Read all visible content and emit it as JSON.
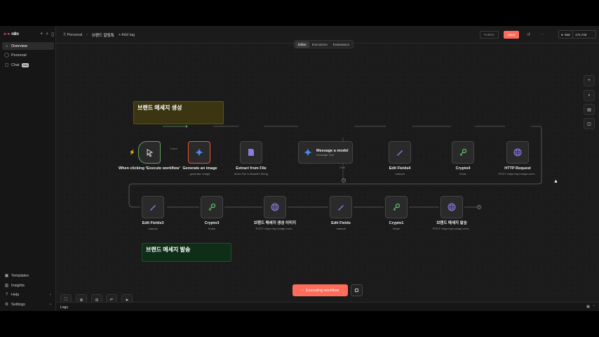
{
  "sidebar": {
    "brand": "n8n",
    "items": [
      {
        "label": "Overview",
        "icon": "home-icon"
      },
      {
        "label": "Personal",
        "icon": "user-icon"
      },
      {
        "label": "Chat",
        "icon": "chat-icon",
        "badge": "beta"
      }
    ],
    "bottom_items": [
      {
        "label": "Templates"
      },
      {
        "label": "Insights"
      },
      {
        "label": "Help"
      },
      {
        "label": "Settings"
      }
    ]
  },
  "header": {
    "project": "Personal",
    "workflow_name": "브랜드 알림톡",
    "add_tag": "+ Add tag",
    "publish": "Publish",
    "save": "Save",
    "star_label": "Star",
    "star_count": "172,746"
  },
  "tabs": [
    "Editor",
    "Executions",
    "Evaluations"
  ],
  "stickies": {
    "top": "브랜드 메세지 생성",
    "bottom": "브랜드 메세지 발송"
  },
  "nodes": {
    "trigger": {
      "label": "When clicking ‘Execute workflow’"
    },
    "gen_image": {
      "label": "Generate an image",
      "sub": "generate: image"
    },
    "extract": {
      "label": "Extract from File",
      "sub": "Move File to Base64 String"
    },
    "message_model": {
      "label": "Message a model",
      "sub": "message: text"
    },
    "edit_fields4": {
      "label": "Edit Fields4",
      "sub": "manual"
    },
    "crypto4": {
      "label": "Crypto4",
      "sub": "hmac"
    },
    "http_request": {
      "label": "HTTP Request",
      "sub": "POST: https://api.solapi.com/..."
    },
    "edit_fields3": {
      "label": "Edit Fields3",
      "sub": "manual"
    },
    "crypto3": {
      "label": "Crypto3",
      "sub": "hmac"
    },
    "brand_image": {
      "label": "브랜드 메세지 생성 이미지",
      "sub": "POST: https://api.solapi.com/..."
    },
    "edit_fields": {
      "label": "Edit Fields",
      "sub": "manual"
    },
    "crypto1": {
      "label": "Crypto1",
      "sub": "hmac"
    },
    "brand_send": {
      "label": "브랜드 메세지 발송",
      "sub": "POST: https://api.solapi.com/..."
    }
  },
  "edge_label": "1 item",
  "tools_label": "Tools",
  "execute_button": "Executing workflow",
  "logs_label": "Logs",
  "colors": {
    "accent": "#ff6d5a",
    "trigger": "#5ba05f"
  }
}
